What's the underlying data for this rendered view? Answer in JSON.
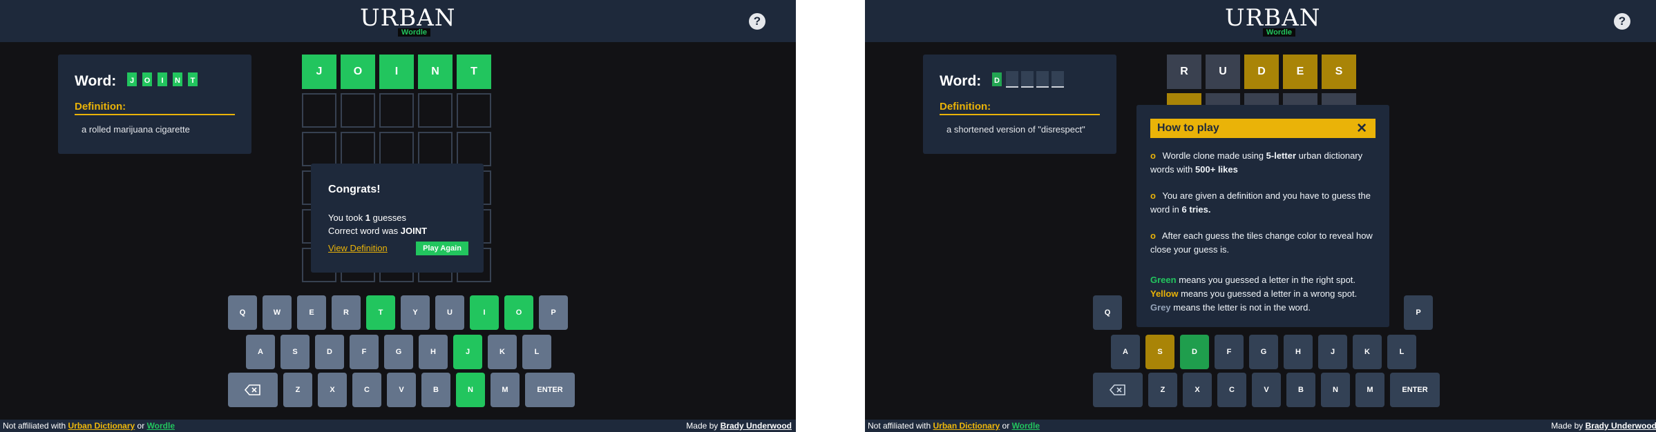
{
  "brand": {
    "logo": "URBAN",
    "sub": "Wordle"
  },
  "help_label": "?",
  "footer": {
    "prefix": "Not affiliated with",
    "ud": "Urban Dictionary",
    "or": "or",
    "wordle": "Wordle",
    "made_by": "Made by",
    "author": "Brady Underwood"
  },
  "left": {
    "word_label": "Word:",
    "hint_tiles": [
      "J",
      "O",
      "I",
      "N",
      "T"
    ],
    "definition_label": "Definition:",
    "definition_text": "a rolled marijuana cigarette",
    "guesses": [
      [
        "J",
        "O",
        "I",
        "N",
        "T"
      ]
    ],
    "congrats": {
      "title": "Congrats!",
      "took_prefix": "You took",
      "count": "1",
      "took_suffix": "guesses",
      "correct_prefix": "Correct word was",
      "correct_word": "JOINT",
      "view_definition": "View Definition",
      "play_again": "Play Again"
    },
    "keys_row1": [
      "Q",
      "W",
      "E",
      "R",
      "T",
      "Y",
      "U",
      "I",
      "O",
      "P"
    ],
    "keys_row2": [
      "A",
      "S",
      "D",
      "F",
      "G",
      "H",
      "J",
      "K",
      "L"
    ],
    "keys_row3": [
      "Z",
      "X",
      "C",
      "V",
      "B",
      "N",
      "M"
    ],
    "enter": "ENTER"
  },
  "right": {
    "word_label": "Word:",
    "hint_first": "D",
    "definition_label": "Definition:",
    "definition_text": "a shortened version of \"disrespect\"",
    "guesses": [
      [
        "R",
        "U",
        "D",
        "E",
        "S"
      ]
    ],
    "howto": {
      "title": "How to play",
      "close": "✕",
      "bullet": "o",
      "p1a": "Wordle clone made using",
      "p1b": "5-letter",
      "p1c": "urban dictionary words with",
      "p1d": "500+ likes",
      "p2a": "You are given a definition and you have to guess the word in",
      "p2b": "6 tries.",
      "p3": "After each guess the tiles change color to reveal how close your guess is.",
      "green": "Green",
      "green_t": "means you guessed a letter in the right spot.",
      "yellow": "Yellow",
      "yellow_t": "means you guessed a letter in a wrong spot.",
      "grey": "Grey",
      "grey_t": "means the letter is not in the word."
    },
    "keys_row1": [
      "Q",
      "P"
    ],
    "keys_row2": [
      "A",
      "S",
      "D",
      "F",
      "G",
      "H",
      "J",
      "K",
      "L"
    ],
    "keys_row3": [
      "Z",
      "X",
      "C",
      "V",
      "B",
      "N",
      "M"
    ],
    "enter": "ENTER"
  },
  "colors": {
    "green": "#22c55e",
    "yellow": "#eab308",
    "bg": "#121215",
    "panel": "#1e293b"
  }
}
